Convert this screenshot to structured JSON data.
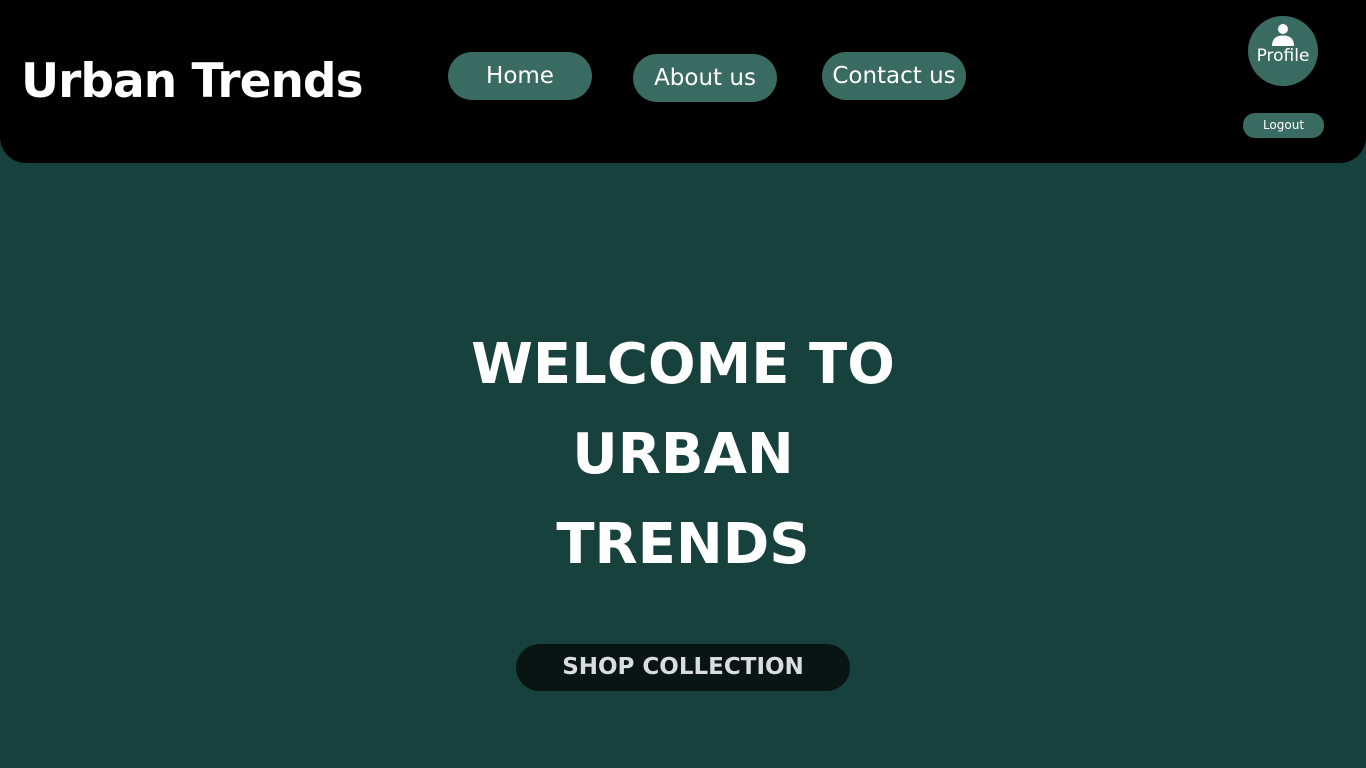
{
  "header": {
    "brand": "Urban Trends",
    "nav": [
      {
        "label": "Home"
      },
      {
        "label": "About us"
      },
      {
        "label": "Contact us"
      }
    ],
    "profile": {
      "label": "Profile",
      "icon": "user-icon"
    },
    "logout_label": "Logout"
  },
  "hero": {
    "lines": [
      "WELCOME TO",
      "URBAN",
      "TRENDS"
    ],
    "cta_label": "SHOP COLLECTION"
  },
  "colors": {
    "background": "#17413d",
    "header_bg": "#000000",
    "pill": "#3a6b60",
    "cta_bg": "#081513",
    "text": "#ffffff"
  }
}
